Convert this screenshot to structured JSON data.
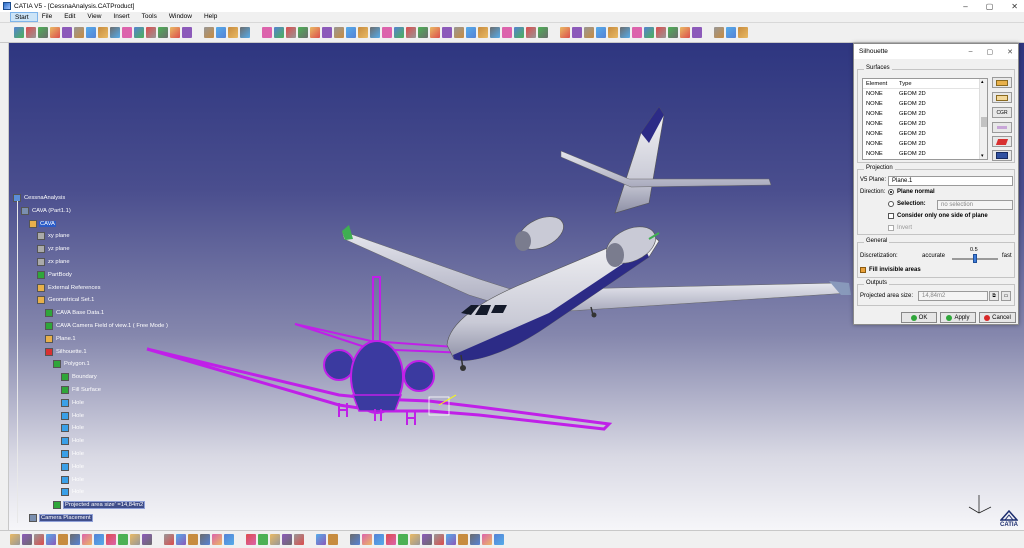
{
  "window": {
    "title": "CATIA V5 - [CessnaAnalysis.CATProduct]",
    "controls": [
      "–",
      "▢",
      "✕"
    ]
  },
  "menubar": {
    "items": [
      "Start",
      "File",
      "Edit",
      "View",
      "Insert",
      "Tools",
      "Window",
      "Help"
    ]
  },
  "tree": {
    "nodes": [
      {
        "label": "CessnaAnalysis"
      },
      {
        "label": "CAVA (Part1.1)"
      },
      {
        "label": "CAVA"
      },
      {
        "label": "xy plane"
      },
      {
        "label": "yz plane"
      },
      {
        "label": "zx plane"
      },
      {
        "label": "PartBody"
      },
      {
        "label": "External References"
      },
      {
        "label": "Geometrical Set.1"
      },
      {
        "label": "CAVA Base Data.1"
      },
      {
        "label": "CAVA Camera Field of view.1 ( Free Mode )"
      },
      {
        "label": "Plane.1"
      },
      {
        "label": "Silhouette.1"
      },
      {
        "label": "Polygon.1"
      },
      {
        "label": "Boundary"
      },
      {
        "label": "Fill Surface"
      },
      {
        "label": "Hole"
      },
      {
        "label": "Hole"
      },
      {
        "label": "Hole"
      },
      {
        "label": "Hole"
      },
      {
        "label": "Hole"
      },
      {
        "label": "Hole"
      },
      {
        "label": "Hole"
      },
      {
        "label": "Hole"
      },
      {
        "label": "Projected area size' =14,84m2"
      },
      {
        "label": "Camera Placement"
      }
    ]
  },
  "dialog": {
    "title": "Silhouette",
    "surfaces": {
      "group_label": "Surfaces",
      "columns": [
        "Element",
        "Type"
      ],
      "rows": [
        [
          "NONE",
          "GEOM 2D"
        ],
        [
          "NONE",
          "GEOM 2D"
        ],
        [
          "NONE",
          "GEOM 2D"
        ],
        [
          "NONE",
          "GEOM 2D"
        ],
        [
          "NONE",
          "GEOM 2D"
        ],
        [
          "NONE",
          "GEOM 2D"
        ],
        [
          "NONE",
          "GEOM 2D"
        ],
        [
          "NONE",
          "GEOM 2D"
        ]
      ],
      "side_buttons": [
        "",
        "",
        "CGR",
        "",
        "",
        ""
      ]
    },
    "projection": {
      "group_label": "Projection",
      "plane_label": "V5 Plane:",
      "plane_value": "Plane.1",
      "direction_label": "Direction:",
      "plane_normal": "Plane normal",
      "selection": "Selection:",
      "selection_placeholder": "no selection",
      "one_side": "Consider only one side of plane",
      "invert": "Invert"
    },
    "general": {
      "group_label": "General",
      "discretization_label": "Discretization:",
      "accurate": "accurate",
      "fast": "fast",
      "slider_value": "0.5",
      "fill_invisible": "Fill invisible areas"
    },
    "outputs": {
      "group_label": "Outputs",
      "projected_label": "Projected area size:",
      "projected_value": "14,84m2"
    },
    "buttons": {
      "ok": "OK",
      "apply": "Apply",
      "cancel": "Cancel"
    }
  },
  "brand": {
    "logo_text": "CATIA"
  },
  "colors": {
    "silhouette": "#c020e8",
    "silhouette_fill": "#3b3aa0",
    "viewport_top": "#2e3680",
    "viewport_bottom": "#f6f6f9"
  }
}
